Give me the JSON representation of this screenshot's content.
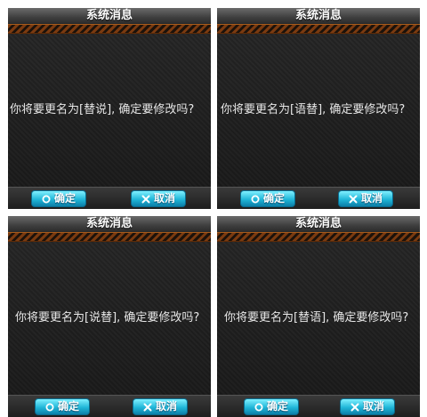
{
  "dialogs": [
    {
      "title": "系统消息",
      "message": "你将要更名为[替说], 确定要修改吗?",
      "ok_label": "确定",
      "cancel_label": "取消"
    },
    {
      "title": "系统消息",
      "message": "你将要更名为[语替], 确定要修改吗?",
      "ok_label": "确定",
      "cancel_label": "取消"
    },
    {
      "title": "系统消息",
      "message": "你将要更名为[说替], 确定要修改吗?",
      "ok_label": "确定",
      "cancel_label": "取消"
    },
    {
      "title": "系统消息",
      "message": "你将要更名为[替语], 确定要修改吗?",
      "ok_label": "确定",
      "cancel_label": "取消"
    }
  ],
  "icons": {
    "ok": "circle-icon",
    "cancel": "cross-icon"
  },
  "colors": {
    "button_accent": "#20b6d8",
    "stripe": "#7a3a10",
    "panel_bg": "#1a1a1a"
  }
}
